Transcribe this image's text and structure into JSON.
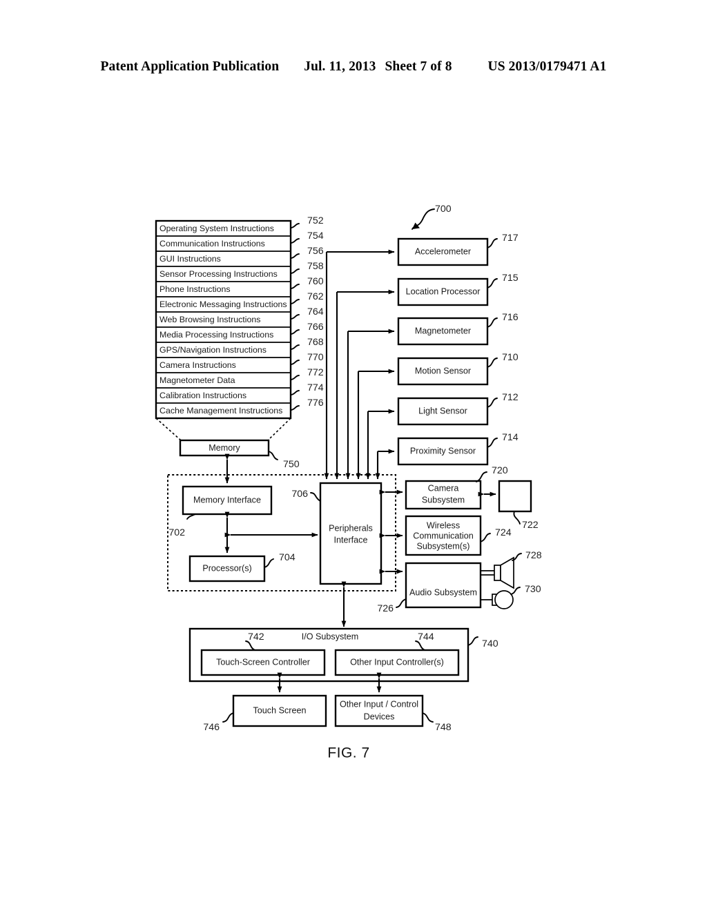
{
  "header": {
    "publication": "Patent Application Publication",
    "date": "Jul. 11, 2013",
    "sheet": "Sheet 7 of 8",
    "number": "US 2013/0179471 A1"
  },
  "figure": {
    "caption": "FIG. 7",
    "system_ref": "700"
  },
  "memory": {
    "label": "Memory",
    "ref": "750",
    "instructions": [
      {
        "label": "Operating System Instructions",
        "ref": "752"
      },
      {
        "label": "Communication Instructions",
        "ref": "754"
      },
      {
        "label": "GUI Instructions",
        "ref": "756"
      },
      {
        "label": "Sensor Processing Instructions",
        "ref": "758"
      },
      {
        "label": "Phone Instructions",
        "ref": "760"
      },
      {
        "label": "Electronic Messaging Instructions",
        "ref": "762"
      },
      {
        "label": "Web Browsing Instructions",
        "ref": "764"
      },
      {
        "label": "Media Processing Instructions",
        "ref": "766"
      },
      {
        "label": "GPS/Navigation Instructions",
        "ref": "768"
      },
      {
        "label": "Camera Instructions",
        "ref": "770"
      },
      {
        "label": "Magnetometer Data",
        "ref": "772"
      },
      {
        "label": "Calibration Instructions",
        "ref": "774"
      },
      {
        "label": "Cache Management Instructions",
        "ref": "776"
      }
    ]
  },
  "core": {
    "enclosure_ref": "702",
    "memory_interface": {
      "label": "Memory Interface"
    },
    "processors": {
      "label": "Processor(s)",
      "ref": "704"
    },
    "peripherals_interface": {
      "label_line1": "Peripherals",
      "label_line2": "Interface",
      "ref": "706"
    }
  },
  "sensors": [
    {
      "label": "Accelerometer",
      "ref": "717"
    },
    {
      "label": "Location Processor",
      "ref": "715"
    },
    {
      "label": "Magnetometer",
      "ref": "716"
    },
    {
      "label": "Motion Sensor",
      "ref": "710"
    },
    {
      "label": "Light Sensor",
      "ref": "712"
    },
    {
      "label": "Proximity Sensor",
      "ref": "714"
    }
  ],
  "subsystems": {
    "camera": {
      "label_line1": "Camera",
      "label_line2": "Subsystem",
      "ref": "720"
    },
    "optical_sensor": {
      "label": "",
      "ref": "722"
    },
    "wireless": {
      "label_line1": "Wireless",
      "label_line2": "Communication",
      "label_line3": "Subsystem(s)",
      "ref": "724"
    },
    "audio": {
      "label": "Audio Subsystem",
      "ref": "726"
    },
    "speaker": {
      "ref": "728"
    },
    "microphone": {
      "ref": "730"
    }
  },
  "io_subsystem": {
    "label": "I/O Subsystem",
    "ref": "740",
    "touch_screen_controller": {
      "label": "Touch-Screen Controller",
      "ref": "742"
    },
    "other_input_controller": {
      "label": "Other Input Controller(s)",
      "ref": "744"
    },
    "touch_screen": {
      "label": "Touch Screen",
      "ref": "746"
    },
    "other_input_devices": {
      "label_line1": "Other Input / Control",
      "label_line2": "Devices",
      "ref": "748"
    }
  }
}
